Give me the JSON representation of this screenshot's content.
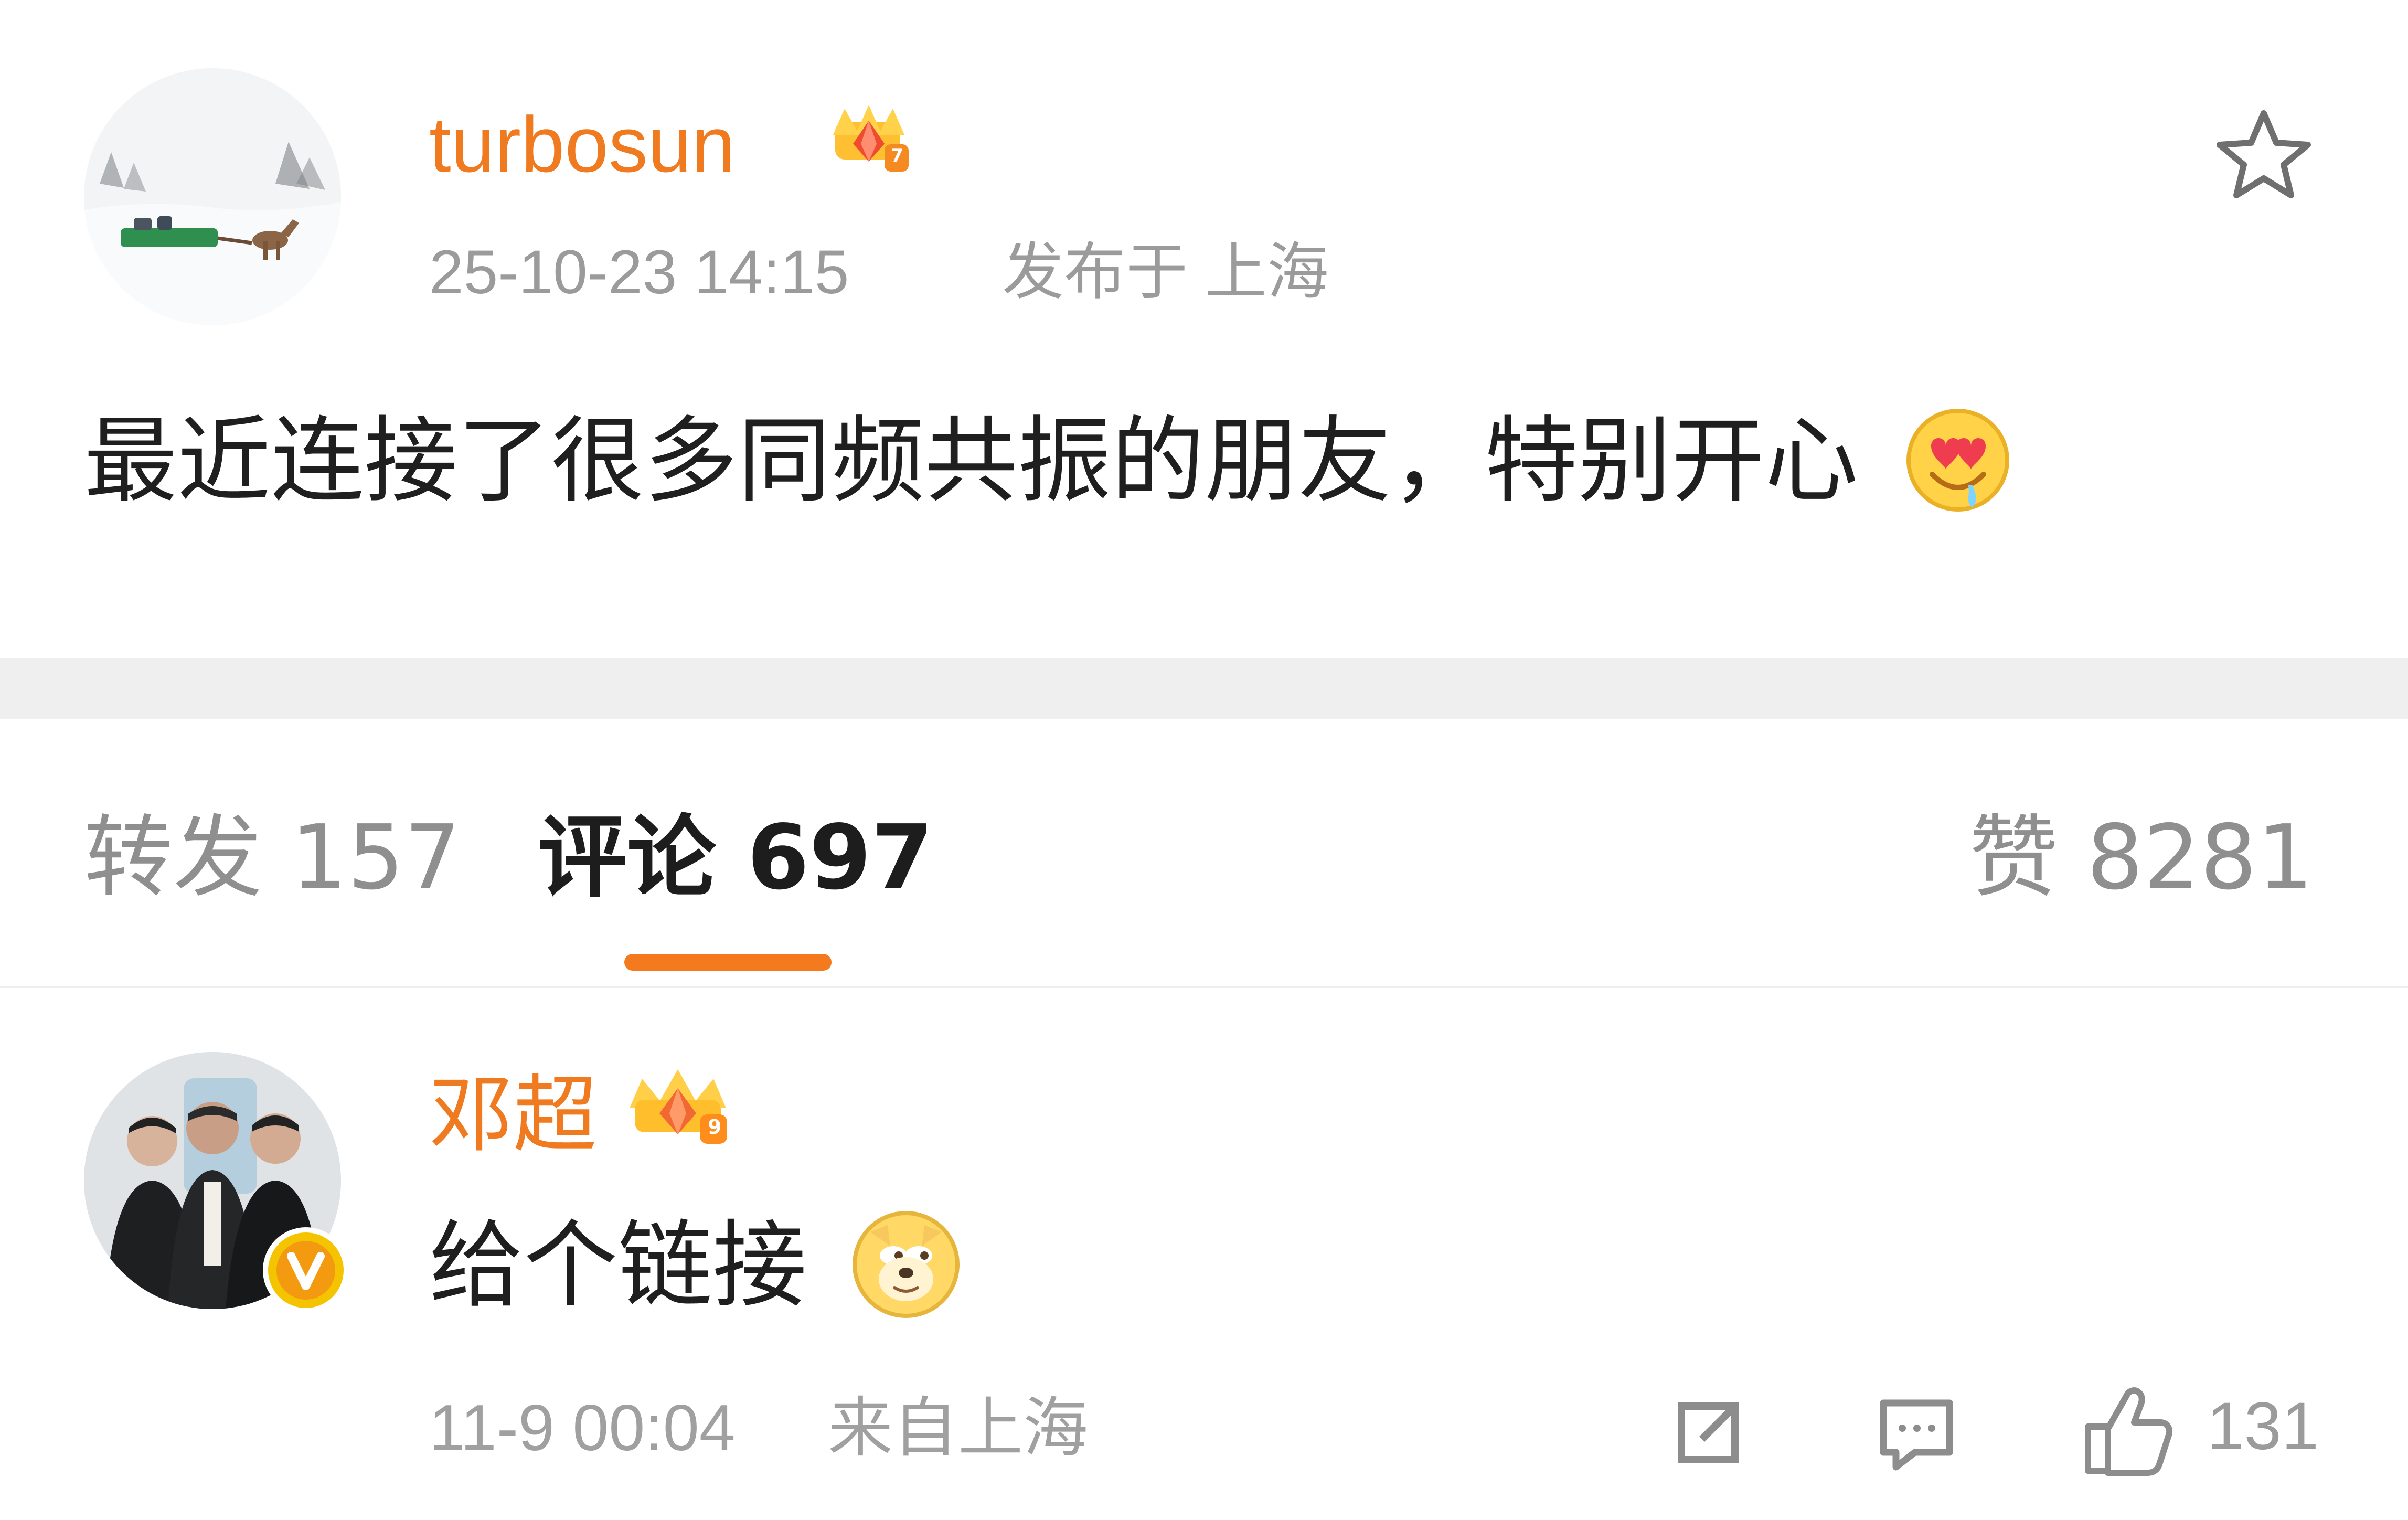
{
  "post": {
    "author": "turbosun",
    "timestamp": "25-10-23 14:15",
    "location": "发布于 上海",
    "text": "最近连接了很多同频共振的朋友，特别开心",
    "badge_level": "7",
    "avatar_icon": "landscape-avatar",
    "favorite_icon": "star-outline-icon"
  },
  "tabs": {
    "repost": "转发 157",
    "comments": "评论 697",
    "likes": "赞 8281",
    "active": "comments",
    "accent": "#f47a1d"
  },
  "comment": {
    "author": "邓超",
    "badge_level": "9",
    "text": "给个链接",
    "timestamp": "11-9 00:04",
    "location": "来自上海",
    "like_count": "131",
    "verified_badge": "V",
    "icons": [
      "share-icon",
      "comment-icon",
      "like-icon"
    ]
  },
  "colors": {
    "username": "#f07a1f",
    "meta": "#9b9b9b",
    "text": "#1f1f1f",
    "band": "#efefef"
  }
}
